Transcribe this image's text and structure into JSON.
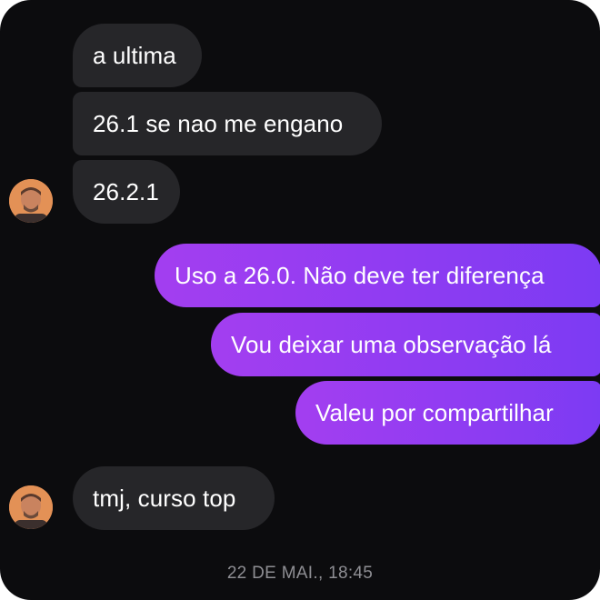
{
  "conversation": {
    "messages": [
      {
        "sender": "other",
        "text": "a ultima"
      },
      {
        "sender": "other",
        "text": "26.1 se nao me engano"
      },
      {
        "sender": "other",
        "text": "26.2.1"
      },
      {
        "sender": "me",
        "text": "Uso a 26.0. Não deve ter diferença"
      },
      {
        "sender": "me",
        "text": "Vou deixar uma observação lá"
      },
      {
        "sender": "me",
        "text": "Valeu por compartilhar"
      },
      {
        "sender": "other",
        "text": "tmj, curso top"
      }
    ],
    "timestamp": "22 DE MAI., 18:45"
  },
  "colors": {
    "background": "#0c0c0e",
    "incoming_bubble": "#262629",
    "outgoing_bubble_start": "#a33ef0",
    "outgoing_bubble_end": "#7c3bf3",
    "timestamp_text": "#8e8e93"
  }
}
